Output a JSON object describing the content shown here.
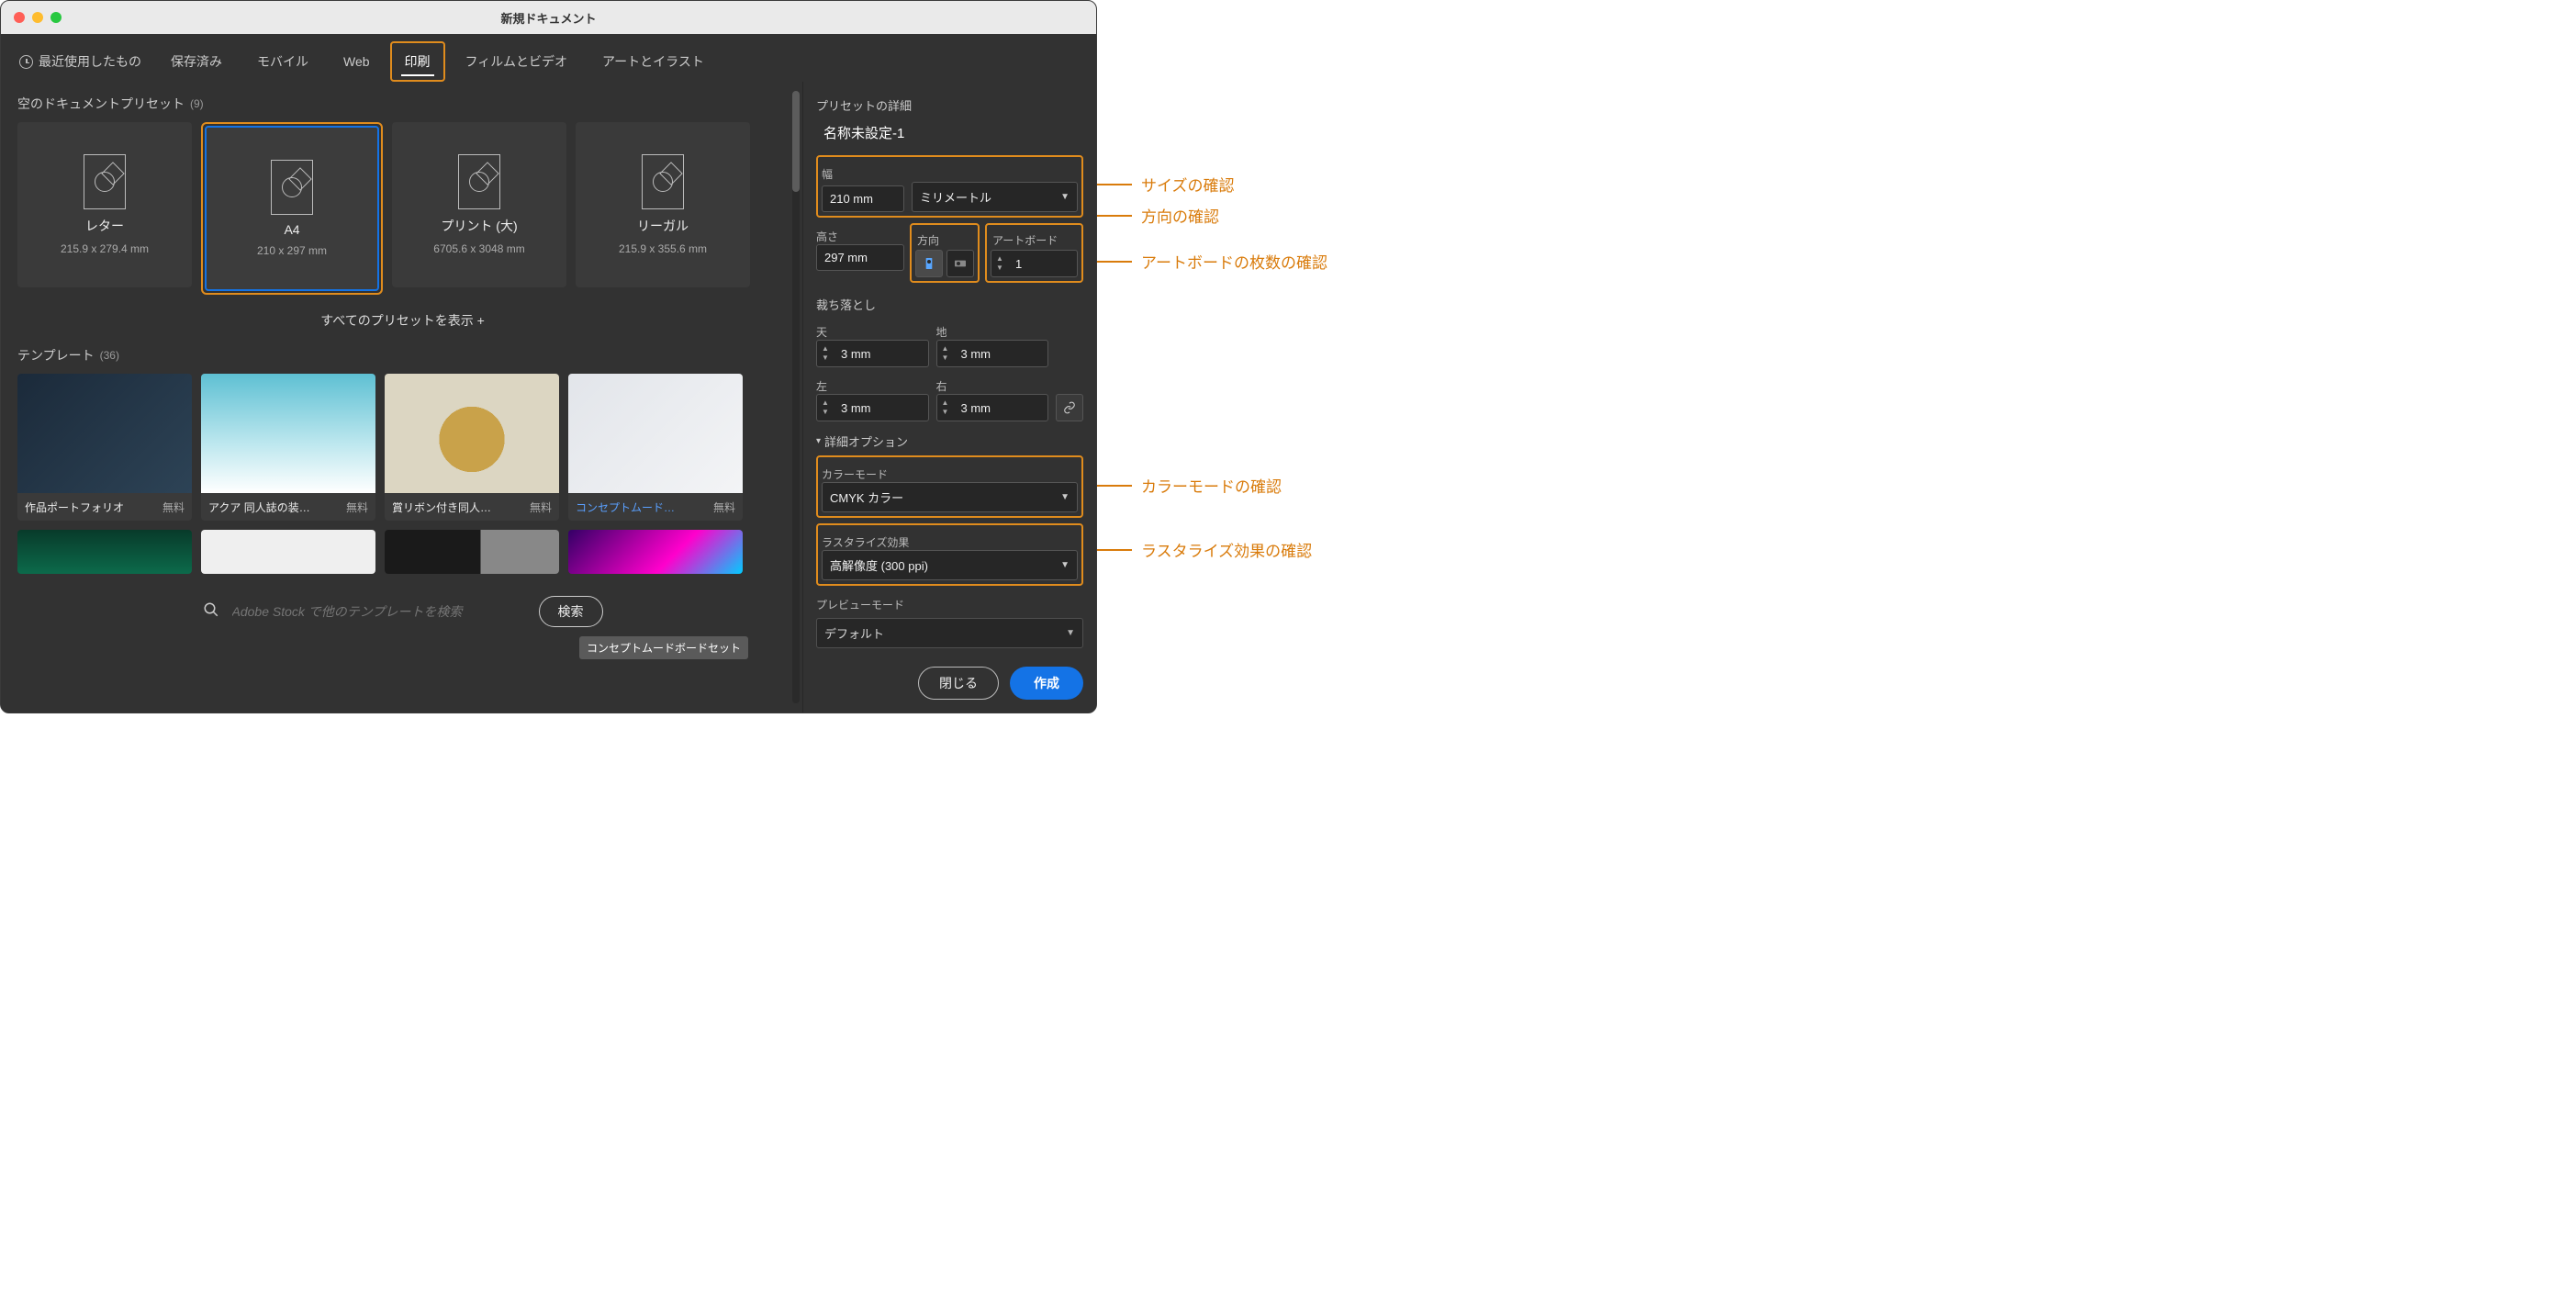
{
  "window_title": "新規ドキュメント",
  "tabs": {
    "recent": "最近使用したもの",
    "saved": "保存済み",
    "mobile": "モバイル",
    "web": "Web",
    "print": "印刷",
    "film": "フィルムとビデオ",
    "art": "アートとイラスト"
  },
  "presets": {
    "heading": "空のドキュメントプリセット",
    "count": "(9)",
    "items": [
      {
        "name": "レター",
        "dims": "215.9 x 279.4 mm"
      },
      {
        "name": "A4",
        "dims": "210 x 297 mm"
      },
      {
        "name": "プリント (大)",
        "dims": "6705.6 x 3048 mm"
      },
      {
        "name": "リーガル",
        "dims": "215.9 x 355.6 mm"
      }
    ],
    "show_all": "すべてのプリセットを表示 +"
  },
  "templates": {
    "heading": "テンプレート",
    "count": "(36)",
    "items": [
      {
        "name": "作品ポートフォリオ",
        "free": "無料"
      },
      {
        "name": "アクア 同人誌の装…",
        "free": "無料"
      },
      {
        "name": "賞リボン付き同人…",
        "free": "無料"
      },
      {
        "name": "コンセプトムード…",
        "free": "無料"
      }
    ],
    "tooltip": "コンセプトムードボードセット"
  },
  "search": {
    "placeholder": "Adobe Stock で他のテンプレートを検索",
    "button": "検索"
  },
  "details": {
    "heading": "プリセットの詳細",
    "name": "名称未設定-1",
    "width_label": "幅",
    "width_value": "210 mm",
    "units_value": "ミリメートル",
    "height_label": "高さ",
    "height_value": "297 mm",
    "orient_label": "方向",
    "artboard_label": "アートボード",
    "artboard_value": "1",
    "bleed_heading": "裁ち落とし",
    "bleed_top_label": "天",
    "bleed_bottom_label": "地",
    "bleed_left_label": "左",
    "bleed_right_label": "右",
    "bleed_value": "3 mm",
    "advanced_heading": "詳細オプション",
    "color_mode_label": "カラーモード",
    "color_mode_value": "CMYK カラー",
    "raster_label": "ラスタライズ効果",
    "raster_value": "高解像度 (300 ppi)",
    "preview_label": "プレビューモード",
    "preview_value": "デフォルト"
  },
  "footer": {
    "close": "閉じる",
    "create": "作成"
  },
  "callouts": {
    "size": "サイズの確認",
    "orientation": "方向の確認",
    "artboards": "アートボードの枚数の確認",
    "color_mode": "カラーモードの確認",
    "raster": "ラスタライズ効果の確認"
  }
}
